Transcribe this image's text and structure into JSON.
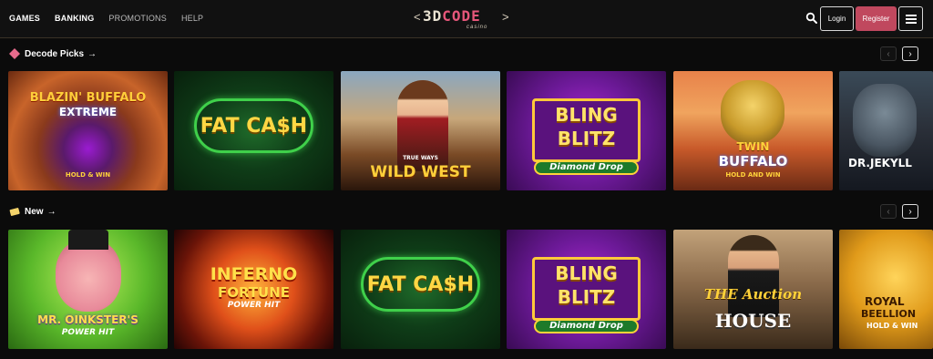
{
  "nav": {
    "items": [
      {
        "label": "GAMES",
        "active": true
      },
      {
        "label": "BANKING",
        "active": true
      },
      {
        "label": "PROMOTIONS",
        "active": false
      },
      {
        "label": "HELP",
        "active": false
      }
    ]
  },
  "logo": {
    "brand_a": "3D",
    "brand_b": "CODE",
    "sub": "casino"
  },
  "header": {
    "login_label": "Login",
    "register_label": "Register"
  },
  "sections": [
    {
      "title": "Decode Picks",
      "icon": "diamond-icon",
      "games": [
        {
          "line1": "BLAZIN' BUFFALO",
          "line2": "EXTREME",
          "line3": "HOLD & WIN"
        },
        {
          "line1": "FAT CA$H",
          "line2": ""
        },
        {
          "line1": "TRUE WAYS",
          "line2": "WILD WEST"
        },
        {
          "line1": "BLING",
          "line2": "BLITZ",
          "line3": "Diamond Drop"
        },
        {
          "line1": "TWIN",
          "line2": "BUFFALO",
          "line3": "HOLD AND WIN"
        },
        {
          "line1": "DR.JEKYLL",
          "line2": ""
        }
      ]
    },
    {
      "title": "New",
      "icon": "ticket-icon",
      "games": [
        {
          "line1": "MR. OINKSTER'S",
          "line2": "POWER HIT"
        },
        {
          "line1": "INFERNO",
          "line2": "FORTUNE",
          "line3": "POWER HIT"
        },
        {
          "line1": "FAT CA$H",
          "line2": ""
        },
        {
          "line1": "BLING",
          "line2": "BLITZ",
          "line3": "Diamond Drop"
        },
        {
          "line1": "THE Auction",
          "line2": "HOUSE"
        },
        {
          "line1": "ROYAL",
          "line2": "BEELLION",
          "line3": "HOLD & WIN"
        }
      ]
    }
  ],
  "colors": {
    "accent": "#c0485e",
    "header_bg": "#111111",
    "page_bg": "#0b0b0b"
  }
}
